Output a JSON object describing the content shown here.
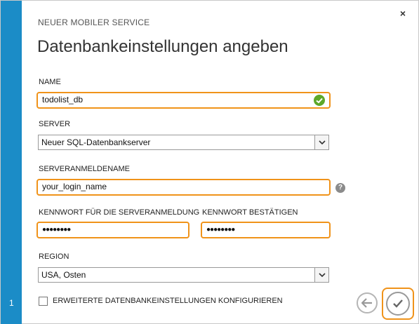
{
  "wizard": {
    "step_number": "1",
    "subtitle": "NEUER MOBILER SERVICE",
    "title": "Datenbankeinstellungen angeben"
  },
  "form": {
    "name_label": "NAME",
    "name_value": "todolist_db",
    "server_label": "SERVER",
    "server_value": "Neuer SQL-Datenbankserver",
    "login_label": "SERVERANMELDENAME",
    "login_value": "your_login_name",
    "password_label": "KENNWORT FÜR DIE SERVERANMELDUNG",
    "password_value": "●●●●●●●●",
    "confirm_label": "KENNWORT BESTÄTIGEN",
    "confirm_value": "●●●●●●●●",
    "region_label": "REGION",
    "region_value": "USA, Osten",
    "advanced_label": "ERWEITERTE DATENBANKEINSTELLUNGEN KONFIGURIEREN",
    "help_glyph": "?"
  },
  "controls": {
    "close_glyph": "×"
  },
  "colors": {
    "accent_orange": "#f0931a",
    "step_bar_blue": "#1b8cc7",
    "valid_green": "#5ea829"
  }
}
